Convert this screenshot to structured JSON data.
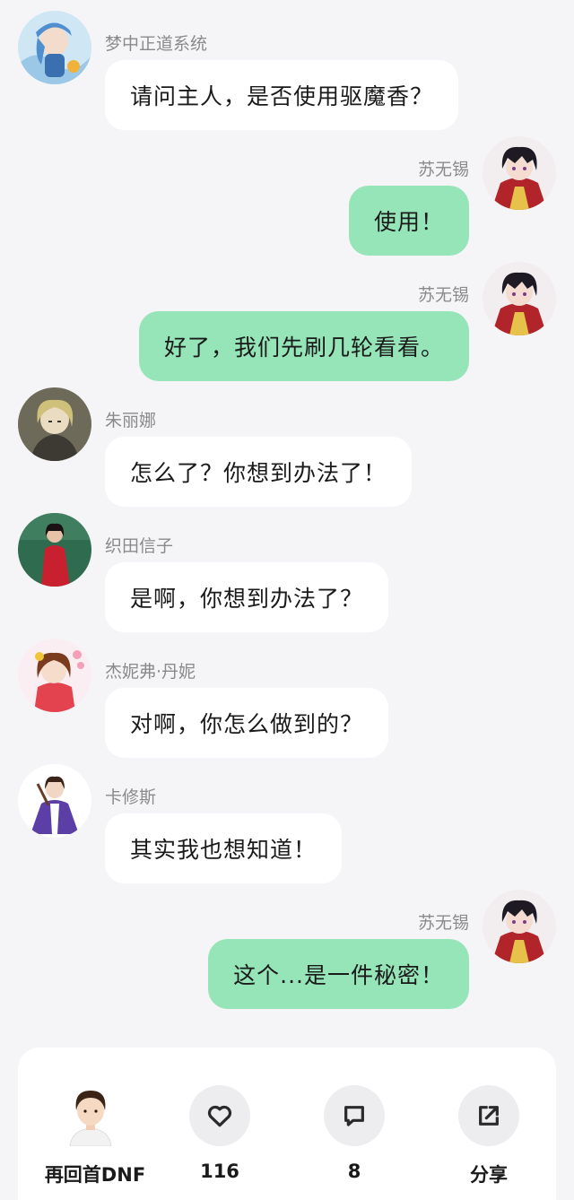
{
  "messages": [
    {
      "side": "left",
      "sender": "梦中正道系统",
      "text": "请问主人，是否使用驱魔香？",
      "avatar": "system-avatar-icon"
    },
    {
      "side": "right",
      "sender": "苏无锡",
      "text": "使用！",
      "avatar": "su-wuxi-avatar-icon"
    },
    {
      "side": "right",
      "sender": "苏无锡",
      "text": "好了，我们先刷几轮看看。",
      "avatar": "su-wuxi-avatar-icon"
    },
    {
      "side": "left",
      "sender": "朱丽娜",
      "text": "怎么了？你想到办法了！",
      "avatar": "zhulina-avatar-icon"
    },
    {
      "side": "left",
      "sender": "织田信子",
      "text": "是啊，你想到办法了？",
      "avatar": "oda-nobuko-avatar-icon"
    },
    {
      "side": "left",
      "sender": "杰妮弗·丹妮",
      "text": "对啊，你怎么做到的？",
      "avatar": "jennifer-avatar-icon"
    },
    {
      "side": "left",
      "sender": "卡修斯",
      "text": "其实我也想知道！",
      "avatar": "cassius-avatar-icon"
    },
    {
      "side": "right",
      "sender": "苏无锡",
      "text": "这个...是一件秘密！",
      "avatar": "su-wuxi-avatar-icon"
    }
  ],
  "bottom_bar": {
    "author_name": "再回首DNF",
    "like_count": "116",
    "comment_count": "8",
    "share_label": "分享"
  },
  "colors": {
    "background": "#f5f5f7",
    "own_bubble": "#95e5b9",
    "other_bubble": "#ffffff",
    "sender_name": "#8a8a8a"
  }
}
